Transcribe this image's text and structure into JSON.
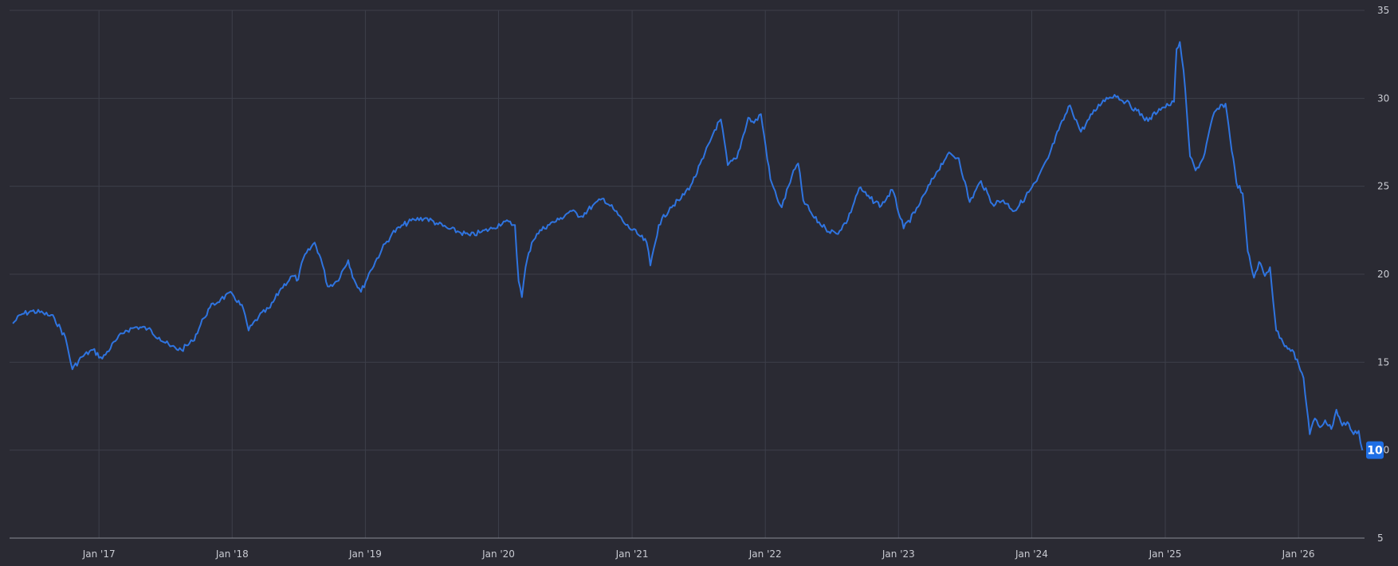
{
  "colors": {
    "background": "#2a2a33",
    "grid": "#3d3f4a",
    "axis_line": "#8a8c96",
    "tick_text": "#c9cbd2",
    "series_line": "#2f74e0",
    "last_value_badge": "#1f6fe5"
  },
  "chart_data": {
    "type": "line",
    "title": "",
    "xlabel": "",
    "ylabel": "",
    "ylim": [
      5,
      35
    ],
    "xlim": [
      "2016-05-01",
      "2026-07-01"
    ],
    "y_ticks": [
      "5",
      "10",
      "15",
      "20",
      "25",
      "30",
      "35"
    ],
    "x_ticks": [
      {
        "date": "2017-01-01",
        "label": "Jan '17"
      },
      {
        "date": "2018-01-01",
        "label": "Jan '18"
      },
      {
        "date": "2019-01-01",
        "label": "Jan '19"
      },
      {
        "date": "2020-01-01",
        "label": "Jan '20"
      },
      {
        "date": "2021-01-01",
        "label": "Jan '21"
      },
      {
        "date": "2022-01-01",
        "label": "Jan '22"
      },
      {
        "date": "2023-01-01",
        "label": "Jan '23"
      },
      {
        "date": "2024-01-01",
        "label": "Jan '24"
      },
      {
        "date": "2025-01-01",
        "label": "Jan '25"
      },
      {
        "date": "2026-01-01",
        "label": "Jan '26"
      }
    ],
    "grid": true,
    "y_axis_position": "right",
    "last_value_label": "10",
    "series": [
      {
        "x": [
          "2016-05-10",
          "2016-06-01",
          "2016-07-01",
          "2016-08-01",
          "2016-09-01",
          "2016-10-01",
          "2016-10-20",
          "2016-11-15",
          "2016-12-15",
          "2017-01-10",
          "2017-02-15",
          "2017-03-15",
          "2017-04-15",
          "2017-05-15",
          "2017-06-15",
          "2017-07-15",
          "2017-08-15",
          "2017-09-15",
          "2017-10-15",
          "2017-11-01",
          "2017-12-01",
          "2018-01-01",
          "2018-02-01",
          "2018-02-15",
          "2018-03-15",
          "2018-04-15",
          "2018-05-15",
          "2018-06-15",
          "2018-07-01",
          "2018-07-15",
          "2018-08-15",
          "2018-09-01",
          "2018-09-20",
          "2018-10-15",
          "2018-11-15",
          "2018-12-01",
          "2018-12-20",
          "2019-01-15",
          "2019-02-15",
          "2019-03-15",
          "2019-04-15",
          "2019-05-15",
          "2019-06-15",
          "2019-07-15",
          "2019-08-15",
          "2019-09-15",
          "2019-10-15",
          "2019-11-15",
          "2019-12-15",
          "2020-01-15",
          "2020-02-15",
          "2020-02-25",
          "2020-03-05",
          "2020-03-15",
          "2020-04-01",
          "2020-04-15",
          "2020-05-15",
          "2020-06-15",
          "2020-07-15",
          "2020-08-15",
          "2020-09-15",
          "2020-10-15",
          "2020-11-15",
          "2020-12-15",
          "2021-01-15",
          "2021-02-10",
          "2021-02-20",
          "2021-03-15",
          "2021-04-15",
          "2021-05-15",
          "2021-06-15",
          "2021-07-15",
          "2021-08-15",
          "2021-09-01",
          "2021-09-20",
          "2021-10-15",
          "2021-11-15",
          "2021-12-01",
          "2021-12-20",
          "2022-01-15",
          "2022-02-01",
          "2022-02-15",
          "2022-03-15",
          "2022-04-01",
          "2022-04-15",
          "2022-05-15",
          "2022-06-15",
          "2022-07-15",
          "2022-08-15",
          "2022-09-15",
          "2022-10-15",
          "2022-11-15",
          "2022-12-15",
          "2023-01-15",
          "2023-02-15",
          "2023-03-15",
          "2023-04-15",
          "2023-05-15",
          "2023-06-15",
          "2023-07-15",
          "2023-08-15",
          "2023-09-15",
          "2023-10-15",
          "2023-11-15",
          "2023-12-15",
          "2024-01-15",
          "2024-02-15",
          "2024-03-15",
          "2024-04-15",
          "2024-05-15",
          "2024-06-15",
          "2024-07-15",
          "2024-08-15",
          "2024-09-15",
          "2024-10-15",
          "2024-11-15",
          "2024-12-15",
          "2025-01-10",
          "2025-01-25",
          "2025-02-01",
          "2025-02-10",
          "2025-02-20",
          "2025-03-10",
          "2025-03-25",
          "2025-04-15",
          "2025-05-15",
          "2025-06-15",
          "2025-07-15",
          "2025-08-01",
          "2025-08-15",
          "2025-09-01",
          "2025-09-15",
          "2025-10-01",
          "2025-10-15",
          "2025-11-01",
          "2025-11-20",
          "2025-12-15",
          "2026-01-15",
          "2026-02-01",
          "2026-02-15",
          "2026-03-01",
          "2026-03-15",
          "2026-04-01",
          "2026-04-15",
          "2026-05-01",
          "2026-05-15",
          "2026-06-01",
          "2026-06-15",
          "2026-06-25"
        ],
        "y": [
          17.2,
          17.7,
          17.9,
          17.8,
          17.5,
          16.4,
          14.6,
          15.3,
          15.7,
          15.2,
          16.2,
          16.8,
          17.0,
          16.9,
          16.4,
          15.9,
          15.7,
          16.2,
          17.5,
          18.1,
          18.6,
          18.9,
          18.0,
          16.8,
          17.6,
          18.1,
          19.2,
          19.9,
          19.7,
          20.9,
          21.8,
          20.9,
          19.3,
          19.6,
          20.8,
          19.7,
          19.0,
          20.2,
          21.4,
          22.3,
          22.8,
          23.1,
          23.2,
          22.9,
          22.6,
          22.4,
          22.2,
          22.4,
          22.6,
          23.0,
          22.8,
          19.6,
          18.7,
          20.4,
          21.8,
          22.3,
          22.8,
          23.1,
          23.6,
          23.3,
          23.9,
          24.3,
          23.6,
          22.8,
          22.3,
          21.8,
          20.5,
          22.8,
          23.8,
          24.3,
          25.2,
          26.6,
          28.2,
          28.8,
          26.2,
          26.6,
          28.9,
          28.6,
          29.1,
          25.4,
          24.4,
          23.8,
          25.6,
          26.3,
          24.2,
          23.2,
          22.6,
          22.3,
          23.1,
          24.9,
          24.3,
          23.9,
          24.8,
          22.6,
          23.5,
          24.6,
          25.8,
          26.8,
          26.6,
          24.1,
          25.3,
          24.0,
          24.2,
          23.6,
          24.4,
          25.3,
          26.6,
          28.2,
          29.6,
          28.1,
          29.1,
          29.9,
          30.2,
          29.8,
          29.3,
          28.7,
          29.4,
          29.6,
          29.8,
          32.8,
          33.2,
          31.6,
          26.7,
          25.9,
          26.6,
          29.2,
          29.7,
          25.2,
          24.6,
          21.3,
          19.8,
          20.7,
          19.9,
          20.4,
          16.8,
          16.1,
          15.7,
          14.1,
          10.9,
          11.8,
          11.3,
          11.7,
          11.2,
          12.3,
          11.4,
          11.6,
          10.9,
          11.1,
          10.0
        ]
      }
    ]
  }
}
